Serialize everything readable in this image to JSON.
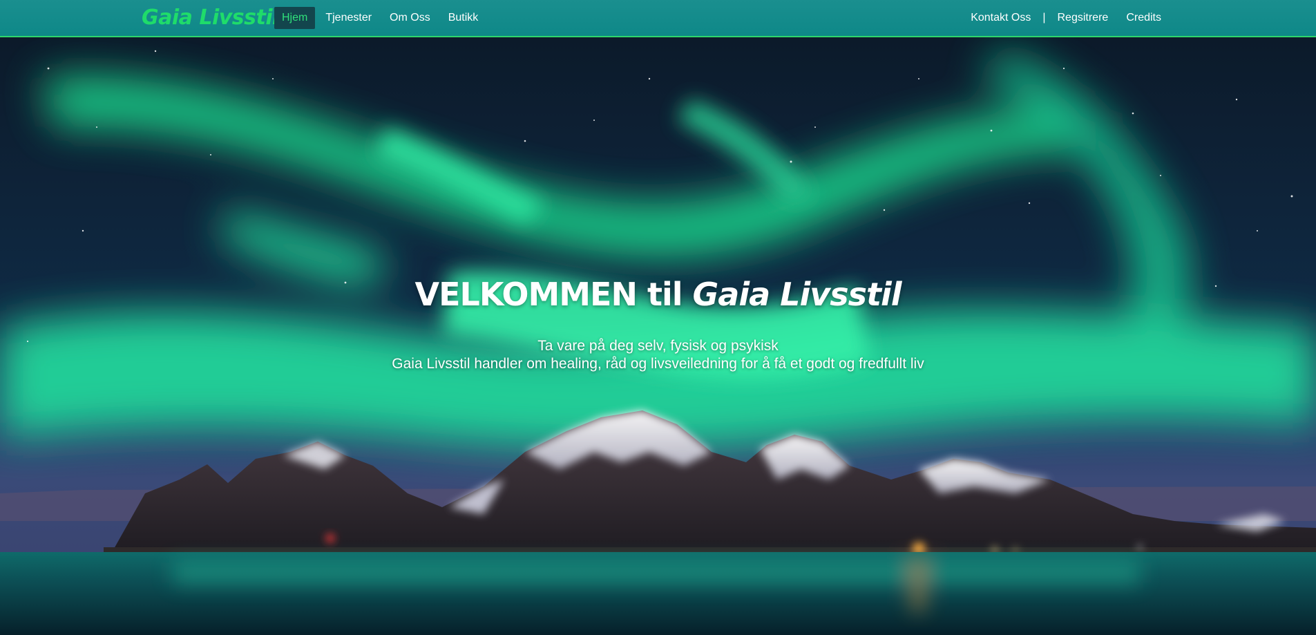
{
  "nav": {
    "brand": "Gaia Livsstil",
    "left_items": [
      {
        "label": "Hjem",
        "active": true
      },
      {
        "label": "Tjenester"
      },
      {
        "label": "Om Oss"
      },
      {
        "label": "Butikk"
      }
    ],
    "right_items": [
      {
        "label": "Kontakt Oss"
      },
      {
        "label": "Regsitrere"
      },
      {
        "label": "Credits"
      }
    ],
    "separator": "|"
  },
  "hero": {
    "title_prefix": "VELKOMMEN til ",
    "title_brand": "Gaia Livsstil",
    "subtitle_line1": "Ta vare på deg selv, fysisk og psykisk",
    "subtitle_line2": "Gaia Livsstil handler om healing, råd og livsveiledning for å få et godt og fredfullt liv",
    "background_image": "aurora-mountains-night"
  },
  "colors": {
    "navbar": "#0e8888",
    "accent_green": "#2fe07a",
    "active_bg": "#13454d",
    "text_white": "#ffffff"
  }
}
